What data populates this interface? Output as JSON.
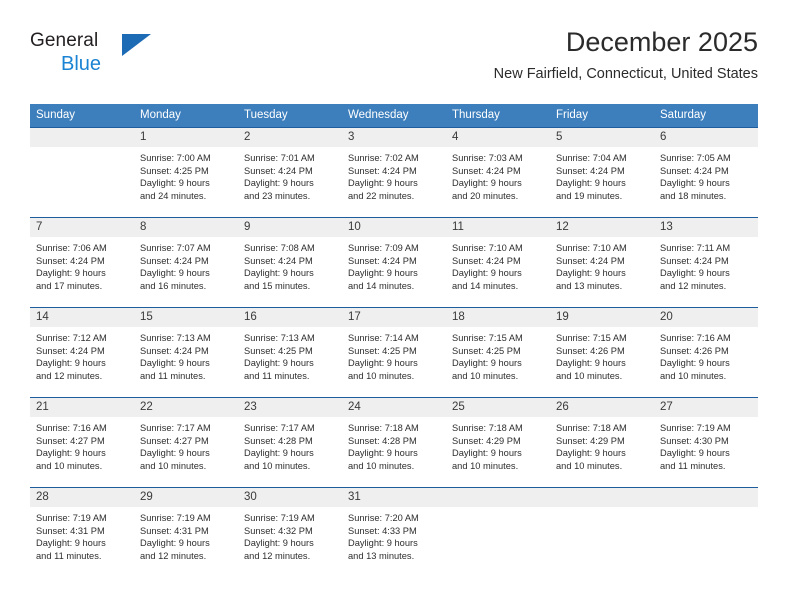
{
  "brand": {
    "name_top": "General",
    "name_bottom": "Blue",
    "triangle_color": "#1d6ab5",
    "blue_color": "#1b83d3"
  },
  "header": {
    "title": "December 2025",
    "subtitle": "New Fairfield, Connecticut, United States"
  },
  "theme": {
    "header_bg": "#3d7ebc",
    "header_text": "#ffffff",
    "row_divider": "#1f5c9e",
    "daynum_band_bg": "#efefef"
  },
  "weekdays": [
    "Sunday",
    "Monday",
    "Tuesday",
    "Wednesday",
    "Thursday",
    "Friday",
    "Saturday"
  ],
  "weeks": [
    [
      {
        "day": "",
        "sunrise": "",
        "sunset": "",
        "daylight_line1": "",
        "daylight_line2": ""
      },
      {
        "day": "1",
        "sunrise": "Sunrise: 7:00 AM",
        "sunset": "Sunset: 4:25 PM",
        "daylight_line1": "Daylight: 9 hours",
        "daylight_line2": "and 24 minutes."
      },
      {
        "day": "2",
        "sunrise": "Sunrise: 7:01 AM",
        "sunset": "Sunset: 4:24 PM",
        "daylight_line1": "Daylight: 9 hours",
        "daylight_line2": "and 23 minutes."
      },
      {
        "day": "3",
        "sunrise": "Sunrise: 7:02 AM",
        "sunset": "Sunset: 4:24 PM",
        "daylight_line1": "Daylight: 9 hours",
        "daylight_line2": "and 22 minutes."
      },
      {
        "day": "4",
        "sunrise": "Sunrise: 7:03 AM",
        "sunset": "Sunset: 4:24 PM",
        "daylight_line1": "Daylight: 9 hours",
        "daylight_line2": "and 20 minutes."
      },
      {
        "day": "5",
        "sunrise": "Sunrise: 7:04 AM",
        "sunset": "Sunset: 4:24 PM",
        "daylight_line1": "Daylight: 9 hours",
        "daylight_line2": "and 19 minutes."
      },
      {
        "day": "6",
        "sunrise": "Sunrise: 7:05 AM",
        "sunset": "Sunset: 4:24 PM",
        "daylight_line1": "Daylight: 9 hours",
        "daylight_line2": "and 18 minutes."
      }
    ],
    [
      {
        "day": "7",
        "sunrise": "Sunrise: 7:06 AM",
        "sunset": "Sunset: 4:24 PM",
        "daylight_line1": "Daylight: 9 hours",
        "daylight_line2": "and 17 minutes."
      },
      {
        "day": "8",
        "sunrise": "Sunrise: 7:07 AM",
        "sunset": "Sunset: 4:24 PM",
        "daylight_line1": "Daylight: 9 hours",
        "daylight_line2": "and 16 minutes."
      },
      {
        "day": "9",
        "sunrise": "Sunrise: 7:08 AM",
        "sunset": "Sunset: 4:24 PM",
        "daylight_line1": "Daylight: 9 hours",
        "daylight_line2": "and 15 minutes."
      },
      {
        "day": "10",
        "sunrise": "Sunrise: 7:09 AM",
        "sunset": "Sunset: 4:24 PM",
        "daylight_line1": "Daylight: 9 hours",
        "daylight_line2": "and 14 minutes."
      },
      {
        "day": "11",
        "sunrise": "Sunrise: 7:10 AM",
        "sunset": "Sunset: 4:24 PM",
        "daylight_line1": "Daylight: 9 hours",
        "daylight_line2": "and 14 minutes."
      },
      {
        "day": "12",
        "sunrise": "Sunrise: 7:10 AM",
        "sunset": "Sunset: 4:24 PM",
        "daylight_line1": "Daylight: 9 hours",
        "daylight_line2": "and 13 minutes."
      },
      {
        "day": "13",
        "sunrise": "Sunrise: 7:11 AM",
        "sunset": "Sunset: 4:24 PM",
        "daylight_line1": "Daylight: 9 hours",
        "daylight_line2": "and 12 minutes."
      }
    ],
    [
      {
        "day": "14",
        "sunrise": "Sunrise: 7:12 AM",
        "sunset": "Sunset: 4:24 PM",
        "daylight_line1": "Daylight: 9 hours",
        "daylight_line2": "and 12 minutes."
      },
      {
        "day": "15",
        "sunrise": "Sunrise: 7:13 AM",
        "sunset": "Sunset: 4:24 PM",
        "daylight_line1": "Daylight: 9 hours",
        "daylight_line2": "and 11 minutes."
      },
      {
        "day": "16",
        "sunrise": "Sunrise: 7:13 AM",
        "sunset": "Sunset: 4:25 PM",
        "daylight_line1": "Daylight: 9 hours",
        "daylight_line2": "and 11 minutes."
      },
      {
        "day": "17",
        "sunrise": "Sunrise: 7:14 AM",
        "sunset": "Sunset: 4:25 PM",
        "daylight_line1": "Daylight: 9 hours",
        "daylight_line2": "and 10 minutes."
      },
      {
        "day": "18",
        "sunrise": "Sunrise: 7:15 AM",
        "sunset": "Sunset: 4:25 PM",
        "daylight_line1": "Daylight: 9 hours",
        "daylight_line2": "and 10 minutes."
      },
      {
        "day": "19",
        "sunrise": "Sunrise: 7:15 AM",
        "sunset": "Sunset: 4:26 PM",
        "daylight_line1": "Daylight: 9 hours",
        "daylight_line2": "and 10 minutes."
      },
      {
        "day": "20",
        "sunrise": "Sunrise: 7:16 AM",
        "sunset": "Sunset: 4:26 PM",
        "daylight_line1": "Daylight: 9 hours",
        "daylight_line2": "and 10 minutes."
      }
    ],
    [
      {
        "day": "21",
        "sunrise": "Sunrise: 7:16 AM",
        "sunset": "Sunset: 4:27 PM",
        "daylight_line1": "Daylight: 9 hours",
        "daylight_line2": "and 10 minutes."
      },
      {
        "day": "22",
        "sunrise": "Sunrise: 7:17 AM",
        "sunset": "Sunset: 4:27 PM",
        "daylight_line1": "Daylight: 9 hours",
        "daylight_line2": "and 10 minutes."
      },
      {
        "day": "23",
        "sunrise": "Sunrise: 7:17 AM",
        "sunset": "Sunset: 4:28 PM",
        "daylight_line1": "Daylight: 9 hours",
        "daylight_line2": "and 10 minutes."
      },
      {
        "day": "24",
        "sunrise": "Sunrise: 7:18 AM",
        "sunset": "Sunset: 4:28 PM",
        "daylight_line1": "Daylight: 9 hours",
        "daylight_line2": "and 10 minutes."
      },
      {
        "day": "25",
        "sunrise": "Sunrise: 7:18 AM",
        "sunset": "Sunset: 4:29 PM",
        "daylight_line1": "Daylight: 9 hours",
        "daylight_line2": "and 10 minutes."
      },
      {
        "day": "26",
        "sunrise": "Sunrise: 7:18 AM",
        "sunset": "Sunset: 4:29 PM",
        "daylight_line1": "Daylight: 9 hours",
        "daylight_line2": "and 10 minutes."
      },
      {
        "day": "27",
        "sunrise": "Sunrise: 7:19 AM",
        "sunset": "Sunset: 4:30 PM",
        "daylight_line1": "Daylight: 9 hours",
        "daylight_line2": "and 11 minutes."
      }
    ],
    [
      {
        "day": "28",
        "sunrise": "Sunrise: 7:19 AM",
        "sunset": "Sunset: 4:31 PM",
        "daylight_line1": "Daylight: 9 hours",
        "daylight_line2": "and 11 minutes."
      },
      {
        "day": "29",
        "sunrise": "Sunrise: 7:19 AM",
        "sunset": "Sunset: 4:31 PM",
        "daylight_line1": "Daylight: 9 hours",
        "daylight_line2": "and 12 minutes."
      },
      {
        "day": "30",
        "sunrise": "Sunrise: 7:19 AM",
        "sunset": "Sunset: 4:32 PM",
        "daylight_line1": "Daylight: 9 hours",
        "daylight_line2": "and 12 minutes."
      },
      {
        "day": "31",
        "sunrise": "Sunrise: 7:20 AM",
        "sunset": "Sunset: 4:33 PM",
        "daylight_line1": "Daylight: 9 hours",
        "daylight_line2": "and 13 minutes."
      },
      {
        "day": "",
        "sunrise": "",
        "sunset": "",
        "daylight_line1": "",
        "daylight_line2": ""
      },
      {
        "day": "",
        "sunrise": "",
        "sunset": "",
        "daylight_line1": "",
        "daylight_line2": ""
      },
      {
        "day": "",
        "sunrise": "",
        "sunset": "",
        "daylight_line1": "",
        "daylight_line2": ""
      }
    ]
  ]
}
